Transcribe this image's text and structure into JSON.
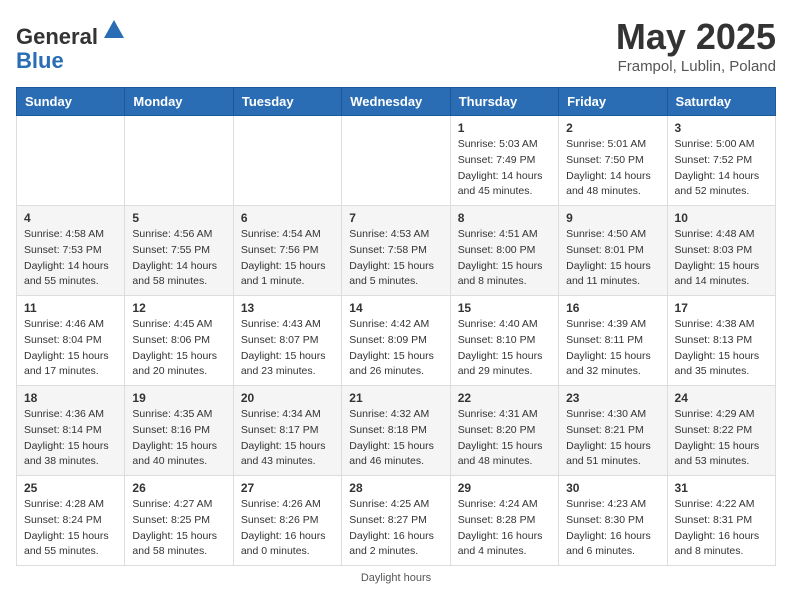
{
  "header": {
    "logo_general": "General",
    "logo_blue": "Blue",
    "month_title": "May 2025",
    "location": "Frampol, Lublin, Poland"
  },
  "weekdays": [
    "Sunday",
    "Monday",
    "Tuesday",
    "Wednesday",
    "Thursday",
    "Friday",
    "Saturday"
  ],
  "weeks": [
    [
      {
        "day": "",
        "info": ""
      },
      {
        "day": "",
        "info": ""
      },
      {
        "day": "",
        "info": ""
      },
      {
        "day": "",
        "info": ""
      },
      {
        "day": "1",
        "info": "Sunrise: 5:03 AM\nSunset: 7:49 PM\nDaylight: 14 hours\nand 45 minutes."
      },
      {
        "day": "2",
        "info": "Sunrise: 5:01 AM\nSunset: 7:50 PM\nDaylight: 14 hours\nand 48 minutes."
      },
      {
        "day": "3",
        "info": "Sunrise: 5:00 AM\nSunset: 7:52 PM\nDaylight: 14 hours\nand 52 minutes."
      }
    ],
    [
      {
        "day": "4",
        "info": "Sunrise: 4:58 AM\nSunset: 7:53 PM\nDaylight: 14 hours\nand 55 minutes."
      },
      {
        "day": "5",
        "info": "Sunrise: 4:56 AM\nSunset: 7:55 PM\nDaylight: 14 hours\nand 58 minutes."
      },
      {
        "day": "6",
        "info": "Sunrise: 4:54 AM\nSunset: 7:56 PM\nDaylight: 15 hours\nand 1 minute."
      },
      {
        "day": "7",
        "info": "Sunrise: 4:53 AM\nSunset: 7:58 PM\nDaylight: 15 hours\nand 5 minutes."
      },
      {
        "day": "8",
        "info": "Sunrise: 4:51 AM\nSunset: 8:00 PM\nDaylight: 15 hours\nand 8 minutes."
      },
      {
        "day": "9",
        "info": "Sunrise: 4:50 AM\nSunset: 8:01 PM\nDaylight: 15 hours\nand 11 minutes."
      },
      {
        "day": "10",
        "info": "Sunrise: 4:48 AM\nSunset: 8:03 PM\nDaylight: 15 hours\nand 14 minutes."
      }
    ],
    [
      {
        "day": "11",
        "info": "Sunrise: 4:46 AM\nSunset: 8:04 PM\nDaylight: 15 hours\nand 17 minutes."
      },
      {
        "day": "12",
        "info": "Sunrise: 4:45 AM\nSunset: 8:06 PM\nDaylight: 15 hours\nand 20 minutes."
      },
      {
        "day": "13",
        "info": "Sunrise: 4:43 AM\nSunset: 8:07 PM\nDaylight: 15 hours\nand 23 minutes."
      },
      {
        "day": "14",
        "info": "Sunrise: 4:42 AM\nSunset: 8:09 PM\nDaylight: 15 hours\nand 26 minutes."
      },
      {
        "day": "15",
        "info": "Sunrise: 4:40 AM\nSunset: 8:10 PM\nDaylight: 15 hours\nand 29 minutes."
      },
      {
        "day": "16",
        "info": "Sunrise: 4:39 AM\nSunset: 8:11 PM\nDaylight: 15 hours\nand 32 minutes."
      },
      {
        "day": "17",
        "info": "Sunrise: 4:38 AM\nSunset: 8:13 PM\nDaylight: 15 hours\nand 35 minutes."
      }
    ],
    [
      {
        "day": "18",
        "info": "Sunrise: 4:36 AM\nSunset: 8:14 PM\nDaylight: 15 hours\nand 38 minutes."
      },
      {
        "day": "19",
        "info": "Sunrise: 4:35 AM\nSunset: 8:16 PM\nDaylight: 15 hours\nand 40 minutes."
      },
      {
        "day": "20",
        "info": "Sunrise: 4:34 AM\nSunset: 8:17 PM\nDaylight: 15 hours\nand 43 minutes."
      },
      {
        "day": "21",
        "info": "Sunrise: 4:32 AM\nSunset: 8:18 PM\nDaylight: 15 hours\nand 46 minutes."
      },
      {
        "day": "22",
        "info": "Sunrise: 4:31 AM\nSunset: 8:20 PM\nDaylight: 15 hours\nand 48 minutes."
      },
      {
        "day": "23",
        "info": "Sunrise: 4:30 AM\nSunset: 8:21 PM\nDaylight: 15 hours\nand 51 minutes."
      },
      {
        "day": "24",
        "info": "Sunrise: 4:29 AM\nSunset: 8:22 PM\nDaylight: 15 hours\nand 53 minutes."
      }
    ],
    [
      {
        "day": "25",
        "info": "Sunrise: 4:28 AM\nSunset: 8:24 PM\nDaylight: 15 hours\nand 55 minutes."
      },
      {
        "day": "26",
        "info": "Sunrise: 4:27 AM\nSunset: 8:25 PM\nDaylight: 15 hours\nand 58 minutes."
      },
      {
        "day": "27",
        "info": "Sunrise: 4:26 AM\nSunset: 8:26 PM\nDaylight: 16 hours\nand 0 minutes."
      },
      {
        "day": "28",
        "info": "Sunrise: 4:25 AM\nSunset: 8:27 PM\nDaylight: 16 hours\nand 2 minutes."
      },
      {
        "day": "29",
        "info": "Sunrise: 4:24 AM\nSunset: 8:28 PM\nDaylight: 16 hours\nand 4 minutes."
      },
      {
        "day": "30",
        "info": "Sunrise: 4:23 AM\nSunset: 8:30 PM\nDaylight: 16 hours\nand 6 minutes."
      },
      {
        "day": "31",
        "info": "Sunrise: 4:22 AM\nSunset: 8:31 PM\nDaylight: 16 hours\nand 8 minutes."
      }
    ]
  ],
  "footer": {
    "note": "Daylight hours"
  }
}
